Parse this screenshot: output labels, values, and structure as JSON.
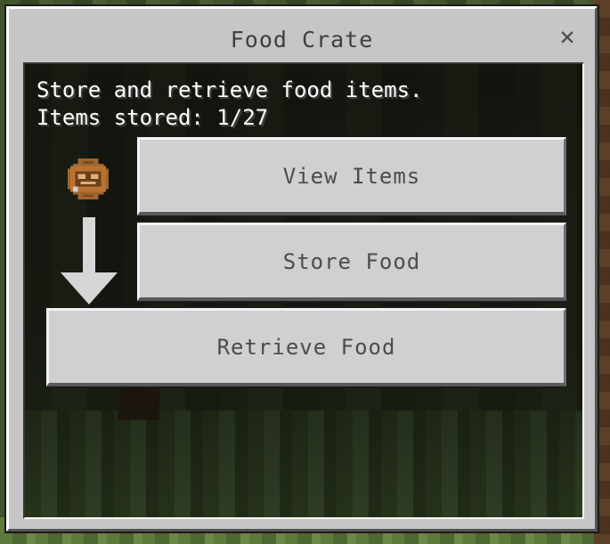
{
  "dialog": {
    "title": "Food Crate",
    "close_icon": "close-icon"
  },
  "content": {
    "line1": "Store and retrieve food items.",
    "line2": "Items stored: 1/27"
  },
  "icons": {
    "crate": "food-crate-icon",
    "arrow": "down-arrow-icon"
  },
  "buttons": {
    "view": "View Items",
    "store": "Store Food",
    "retrieve": "Retrieve Food"
  },
  "colors": {
    "panel": "#c6c6c6",
    "button": "#d0d0d0",
    "button_text": "#4c4c4c",
    "title_text": "#3f3f3f",
    "desc_text": "#ffffff"
  }
}
